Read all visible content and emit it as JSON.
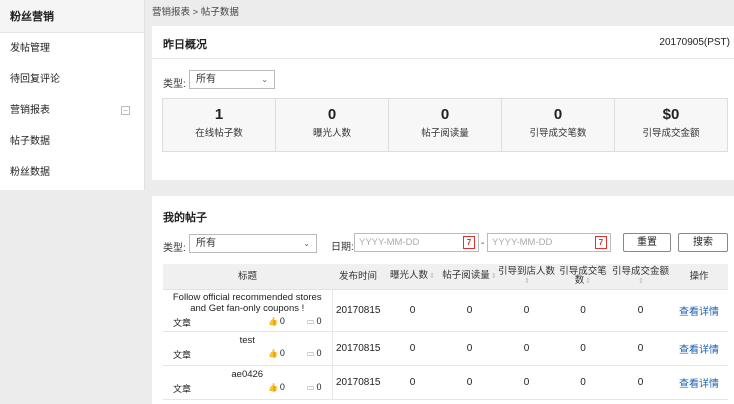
{
  "sidebar": {
    "header": "粉丝营销",
    "items": [
      {
        "label": "发帖管理"
      },
      {
        "label": "待回复评论"
      },
      {
        "label": "营销报表",
        "collapse": "−"
      },
      {
        "label": "帖子数据"
      },
      {
        "label": "粉丝数据"
      }
    ]
  },
  "breadcrumb": "营销报表 > 帖子数据",
  "overview": {
    "title": "昨日概况",
    "date": "20170905(PST)",
    "type_label": "类型:",
    "type_value": "所有",
    "stats": [
      {
        "value": "1",
        "label": "在线帖子数"
      },
      {
        "value": "0",
        "label": "曝光人数"
      },
      {
        "value": "0",
        "label": "帖子阅读量"
      },
      {
        "value": "0",
        "label": "引导成交笔数"
      },
      {
        "value": "$0",
        "label": "引导成交金额"
      }
    ]
  },
  "posts": {
    "title": "我的帖子",
    "type_label": "类型:",
    "type_value": "所有",
    "date_label": "日期:",
    "date_from_placeholder": "YYYY-MM-DD",
    "date_to_placeholder": "YYYY-MM-DD",
    "date_sep": "-",
    "calendar_glyph": "7",
    "reset_label": "重置",
    "search_label": "搜索",
    "columns": [
      "标题",
      "发布时间",
      "曝光人数",
      "帖子阅读量",
      "引导到店人数",
      "引导成交笔数",
      "引导成交金额",
      "操作"
    ],
    "rows": [
      {
        "title": "Follow official recommended stores and Get fan-only coupons !",
        "category": "文章",
        "likes": "0",
        "comments": "0",
        "date": "20170815",
        "exposure": "0",
        "reads": "0",
        "visits": "0",
        "orders": "0",
        "amount": "0",
        "action": "查看详情"
      },
      {
        "title": "test",
        "category": "文章",
        "likes": "0",
        "comments": "0",
        "date": "20170815",
        "exposure": "0",
        "reads": "0",
        "visits": "0",
        "orders": "0",
        "amount": "0",
        "action": "查看详情"
      },
      {
        "title": "ae0426",
        "category": "文章",
        "likes": "0",
        "comments": "0",
        "date": "20170815",
        "exposure": "0",
        "reads": "0",
        "visits": "0",
        "orders": "0",
        "amount": "0",
        "action": "查看详情"
      }
    ]
  },
  "colors": {
    "link": "#1a5fb4",
    "calendar": "#dd3333",
    "background": "#ececec"
  }
}
